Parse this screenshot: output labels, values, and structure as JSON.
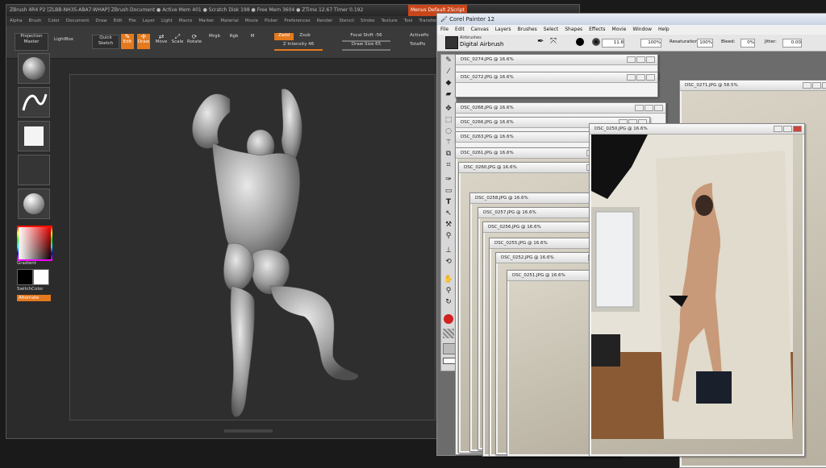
{
  "zbrush": {
    "title": "ZBrush 4R4 P2  [ZLBB-NH35-ABA7-WHAP]  ZBrush Document     ● Active Mem 401 ● Scratch Disk 198 ● Free Mem 3604 ● ZTime 12.67  Timer 0.192",
    "title_right": "Menus   Default ZScript",
    "menu": [
      "Alpha",
      "Brush",
      "Color",
      "Document",
      "Draw",
      "Edit",
      "File",
      "Layer",
      "Light",
      "Macro",
      "Marker",
      "Material",
      "Movie",
      "Picker",
      "Preferences",
      "Render",
      "Stencil",
      "Stroke",
      "Texture",
      "Tool",
      "Transform",
      "Zplugin",
      "Zscript"
    ],
    "toolbar": {
      "projection_master": "Projection Master",
      "lightbox": "LightBox",
      "quick_sketch": "Quick Sketch",
      "edit": "Edit",
      "draw": "Draw",
      "move": "Move",
      "scale": "Scale",
      "rotate": "Rotate",
      "mrgb": "Mrgb",
      "rgb": "Rgb",
      "m": "M",
      "zadd": "Zadd",
      "zsub": "Zsub",
      "z_intensity": "Z Intensity 46",
      "focal_shift": "Focal Shift -56",
      "draw_size": "Draw Size 65",
      "active_points": "ActivePo",
      "total_points": "TotalPo"
    },
    "left_panel": {
      "gradient": "Gradient",
      "switchcolor": "SwitchColor",
      "alternate": "Alternate"
    }
  },
  "painter": {
    "title": "Corel Painter 12",
    "menu": [
      "File",
      "Edit",
      "Canvas",
      "Layers",
      "Brushes",
      "Select",
      "Shapes",
      "Effects",
      "Movie",
      "Window",
      "Help"
    ],
    "brush_category": "Airbrushes",
    "brush_variant": "Digital Airbrush",
    "size_value": "11.8",
    "opacity_value": "100%",
    "resaturation_label": "Resaturation:",
    "resaturation_value": "100%",
    "bleed_label": "Bleed:",
    "bleed_value": "0%",
    "jitter_label": "Jitter:",
    "jitter_value": "0.00",
    "documents": [
      {
        "title": "DSC_0274.JPG @ 16.6%"
      },
      {
        "title": "DSC_0272.JPG @ 16.6%"
      },
      {
        "title": "DSC_0271.JPG @ 58.5%"
      },
      {
        "title": "DSC_0268.JPG @ 16.6%"
      },
      {
        "title": "DSC_0266.JPG @ 16.6%"
      },
      {
        "title": "DSC_0263.JPG @ 16.6%"
      },
      {
        "title": "DSC_0261.JPG @ 16.6%"
      },
      {
        "title": "DSC_0260.JPG @ 16.6%"
      },
      {
        "title": "DSC_0258.JPG @ 16.6%"
      },
      {
        "title": "DSC_0257.JPG @ 16.6%"
      },
      {
        "title": "DSC_0256.JPG @ 16.6%"
      },
      {
        "title": "DSC_0255.JPG @ 16.6%"
      },
      {
        "title": "DSC_0252.JPG @ 16.6%"
      },
      {
        "title": "DSC_0251.JPG @ 16.6%"
      },
      {
        "title": "DSC_0250.JPG @ 16.6%"
      }
    ]
  },
  "colors": {
    "zbrush_accent": "#e5791e",
    "primary_color": "#d32020"
  }
}
